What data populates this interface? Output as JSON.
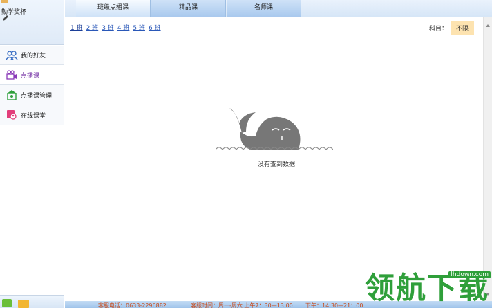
{
  "profile": {
    "top_text": "",
    "award_text": "勤学奖杯"
  },
  "sidebar": {
    "items": [
      {
        "label": "我的好友",
        "icon": "friends-icon"
      },
      {
        "label": "点播课",
        "icon": "video-icon"
      },
      {
        "label": "点播课管理",
        "icon": "course-manage-icon"
      },
      {
        "label": "在线课堂",
        "icon": "online-class-icon"
      }
    ],
    "bottom_icons": [
      "chat-icon",
      "folder-icon"
    ]
  },
  "tabs": [
    {
      "label": "班级点播课"
    },
    {
      "label": "精品课"
    },
    {
      "label": "名师课"
    }
  ],
  "class_links": [
    "1 班",
    "2 班",
    "3 班",
    "4 班",
    "5 班",
    "6 班"
  ],
  "subject": {
    "label": "科目：",
    "value": "不限"
  },
  "empty_state": {
    "text": "没有查到数据",
    "icon": "whale-icon"
  },
  "footer": {
    "hotline": "客服电话：0633-2296882",
    "hours": "客服时间：周一-周六 上午7：30—13:00",
    "afternoon": "下午：14:30—21：00"
  },
  "watermark": {
    "text": "领航下载",
    "url": "lhdown.com"
  },
  "colors": {
    "tab_active": "#cfe3f8",
    "sidebar_active_text": "#7a3aa8",
    "subject_badge": "#fde3b0",
    "watermark_green": "#2f9f3a"
  }
}
